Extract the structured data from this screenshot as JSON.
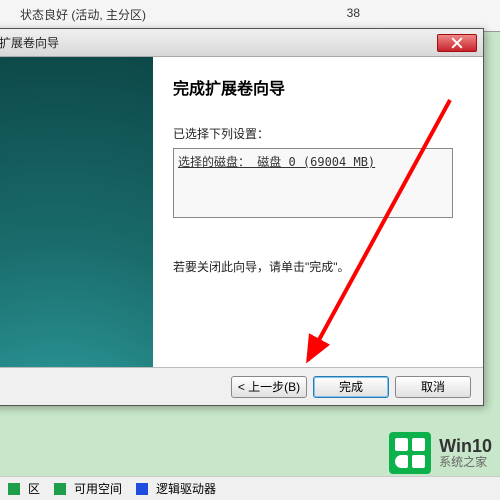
{
  "background": {
    "partition_status": "状态良好 (活动, 主分区)",
    "partition_num": "38"
  },
  "dialog": {
    "title": "扩展卷向导",
    "heading": "完成扩展卷向导",
    "selected_label": "已选择下列设置：",
    "selected_item": "选择的磁盘：  磁盘 0 (69004 MB)",
    "hint": "若要关闭此向导，请单击\"完成\"。",
    "buttons": {
      "back": "< 上一步(B)",
      "finish": "完成",
      "cancel": "取消"
    }
  },
  "legend": {
    "item1": "区",
    "item2": "可用空间",
    "item3": "逻辑驱动器",
    "color1": "#1e9e4a",
    "color2": "#1e4ee0"
  },
  "watermark": {
    "line1": "Win10",
    "line2": "系统之家"
  }
}
